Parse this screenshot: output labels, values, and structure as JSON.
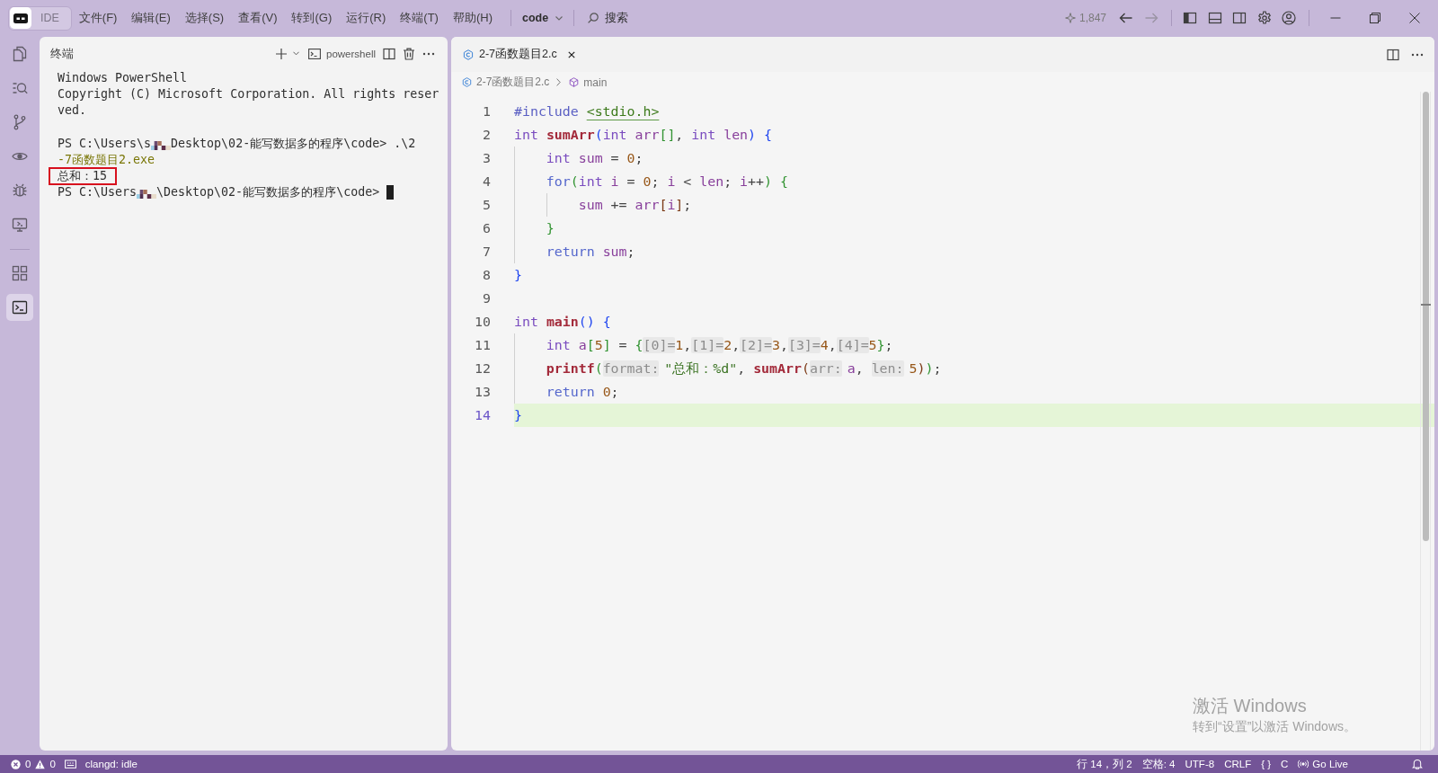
{
  "title_bar": {
    "app_label": "IDE",
    "menus": [
      "文件(F)",
      "编辑(E)",
      "选择(S)",
      "查看(V)",
      "转到(G)",
      "运行(R)",
      "终端(T)",
      "帮助(H)"
    ],
    "workspace": "code",
    "search_label": "搜索",
    "credits": "1,847",
    "nav": [
      {
        "kind": "back",
        "disabled": false
      },
      {
        "kind": "forward",
        "disabled": true
      }
    ],
    "layout_toggles": [
      {
        "kind": "primary",
        "on": true
      },
      {
        "kind": "panel",
        "on": false
      },
      {
        "kind": "secondary",
        "on": false
      }
    ]
  },
  "activity_bar": {
    "groups": [
      {
        "items": [
          {
            "kind": "explorer",
            "selected": false
          },
          {
            "kind": "search",
            "selected": false
          },
          {
            "kind": "scm",
            "selected": false
          },
          {
            "kind": "preview",
            "selected": false
          },
          {
            "kind": "debug",
            "selected": false
          },
          {
            "kind": "remote",
            "selected": false
          }
        ]
      },
      {
        "items": [
          {
            "kind": "extensions",
            "selected": false
          },
          {
            "kind": "terminal",
            "selected": true
          }
        ]
      }
    ]
  },
  "terminal": {
    "title": "终端",
    "shell": "powershell",
    "lines": [
      {
        "kind": "text",
        "boxed": false,
        "cursor": false,
        "segments": [
          {
            "kind": "text",
            "text": "Windows PowerShell"
          }
        ]
      },
      {
        "kind": "text",
        "boxed": false,
        "cursor": false,
        "segments": [
          {
            "kind": "text",
            "text": "Copyright (C) Microsoft Corporation. All rights reser"
          }
        ]
      },
      {
        "kind": "text",
        "boxed": false,
        "cursor": false,
        "segments": [
          {
            "kind": "text",
            "text": "ved."
          }
        ]
      },
      {
        "kind": "blank",
        "boxed": false,
        "cursor": false
      },
      {
        "kind": "text",
        "boxed": false,
        "cursor": false,
        "segments": [
          {
            "kind": "text",
            "text": "PS C:\\Users\\s"
          },
          {
            "kind": "redacted"
          },
          {
            "kind": "text",
            "text": "Desktop\\02-能写数据多的程序\\code> .\\2"
          }
        ]
      },
      {
        "kind": "text",
        "boxed": false,
        "cursor": false,
        "segments": [
          {
            "kind": "command",
            "text": "-7函数题目2.exe"
          }
        ]
      },
      {
        "kind": "text",
        "boxed": true,
        "cursor": false,
        "segments": [
          {
            "kind": "text",
            "text": "总和：15"
          }
        ]
      },
      {
        "kind": "text",
        "boxed": false,
        "cursor": true,
        "segments": [
          {
            "kind": "text",
            "text": "PS C:\\Users"
          },
          {
            "kind": "redacted"
          },
          {
            "kind": "text",
            "text": "\\Desktop\\02-能写数据多的程序\\code> "
          }
        ]
      }
    ]
  },
  "editor": {
    "tabs": [
      {
        "label": "2-7函数题目2.c",
        "selected": true
      }
    ],
    "breadcrumb": [
      {
        "kind": "file",
        "label": "2-7函数题目2.c"
      },
      {
        "kind": "function",
        "label": "main"
      }
    ],
    "lines": [
      {
        "number": "1",
        "current": false,
        "tokens": [
          {
            "kind": "directive",
            "text": "#include "
          },
          {
            "kind": "header",
            "text": "<stdio.h>"
          }
        ]
      },
      {
        "number": "2",
        "current": false,
        "tokens": [
          {
            "kind": "type",
            "text": "int "
          },
          {
            "kind": "func",
            "text": "sumArr"
          },
          {
            "kind": "bracket",
            "text": "("
          },
          {
            "kind": "type",
            "text": "int "
          },
          {
            "kind": "var",
            "text": "arr"
          },
          {
            "kind": "bracket2",
            "text": "[]"
          },
          {
            "kind": "punct",
            "text": ", "
          },
          {
            "kind": "type",
            "text": "int "
          },
          {
            "kind": "var",
            "text": "len"
          },
          {
            "kind": "bracket",
            "text": ") {"
          }
        ],
        "children": [
          {
            "number": "3",
            "current": false,
            "tokens": [
              {
                "kind": "type",
                "text": "int "
              },
              {
                "kind": "var",
                "text": "sum"
              },
              {
                "kind": "punct",
                "text": " = "
              },
              {
                "kind": "num",
                "text": "0"
              },
              {
                "kind": "punct",
                "text": ";"
              }
            ]
          },
          {
            "number": "4",
            "current": false,
            "tokens": [
              {
                "kind": "keyword",
                "text": "for"
              },
              {
                "kind": "bracket2",
                "text": "("
              },
              {
                "kind": "type",
                "text": "int "
              },
              {
                "kind": "var",
                "text": "i"
              },
              {
                "kind": "punct",
                "text": " = "
              },
              {
                "kind": "num",
                "text": "0"
              },
              {
                "kind": "punct",
                "text": "; "
              },
              {
                "kind": "var",
                "text": "i"
              },
              {
                "kind": "punct",
                "text": " < "
              },
              {
                "kind": "var",
                "text": "len"
              },
              {
                "kind": "punct",
                "text": "; "
              },
              {
                "kind": "var",
                "text": "i"
              },
              {
                "kind": "punct",
                "text": "++"
              },
              {
                "kind": "bracket2",
                "text": ") {"
              }
            ],
            "children": [
              {
                "number": "5",
                "current": false,
                "tokens": [
                  {
                    "kind": "var",
                    "text": "sum"
                  },
                  {
                    "kind": "punct",
                    "text": " += "
                  },
                  {
                    "kind": "var",
                    "text": "arr"
                  },
                  {
                    "kind": "bracket3",
                    "text": "["
                  },
                  {
                    "kind": "var",
                    "text": "i"
                  },
                  {
                    "kind": "bracket3",
                    "text": "]"
                  },
                  {
                    "kind": "punct",
                    "text": ";"
                  }
                ]
              }
            ]
          },
          {
            "number": "6",
            "current": false,
            "tokens": [
              {
                "kind": "bracket2",
                "text": "}"
              }
            ]
          },
          {
            "number": "7",
            "current": false,
            "tokens": [
              {
                "kind": "keyword",
                "text": "return "
              },
              {
                "kind": "var",
                "text": "sum"
              },
              {
                "kind": "punct",
                "text": ";"
              }
            ]
          }
        ]
      },
      {
        "number": "8",
        "current": false,
        "tokens": [
          {
            "kind": "bracket",
            "text": "}"
          }
        ]
      },
      {
        "number": "9",
        "current": false
      },
      {
        "number": "10",
        "current": false,
        "tokens": [
          {
            "kind": "type",
            "text": "int "
          },
          {
            "kind": "func",
            "text": "main"
          },
          {
            "kind": "bracket",
            "text": "() {"
          }
        ],
        "children": [
          {
            "number": "11",
            "current": false,
            "tokens": [
              {
                "kind": "type",
                "text": "int "
              },
              {
                "kind": "var",
                "text": "a"
              },
              {
                "kind": "bracket2",
                "text": "["
              },
              {
                "kind": "num",
                "text": "5"
              },
              {
                "kind": "bracket2",
                "text": "]"
              },
              {
                "kind": "punct",
                "text": " = "
              },
              {
                "kind": "bracket2",
                "text": "{"
              },
              {
                "kind": "designator",
                "text": "[0]="
              },
              {
                "kind": "num",
                "text": "1"
              },
              {
                "kind": "punct",
                "text": ","
              },
              {
                "kind": "designator",
                "text": "[1]="
              },
              {
                "kind": "num",
                "text": "2"
              },
              {
                "kind": "punct",
                "text": ","
              },
              {
                "kind": "designator",
                "text": "[2]="
              },
              {
                "kind": "num",
                "text": "3"
              },
              {
                "kind": "punct",
                "text": ","
              },
              {
                "kind": "designator",
                "text": "[3]="
              },
              {
                "kind": "num",
                "text": "4"
              },
              {
                "kind": "punct",
                "text": ","
              },
              {
                "kind": "designator",
                "text": "[4]="
              },
              {
                "kind": "num",
                "text": "5"
              },
              {
                "kind": "bracket2",
                "text": "}"
              },
              {
                "kind": "punct",
                "text": ";"
              }
            ]
          },
          {
            "number": "12",
            "current": false,
            "tokens": [
              {
                "kind": "func",
                "text": "printf"
              },
              {
                "kind": "bracket2",
                "text": "("
              },
              {
                "kind": "hint",
                "text": "format:"
              },
              {
                "kind": "str",
                "text": "\"总和：%d\""
              },
              {
                "kind": "punct",
                "text": ", "
              },
              {
                "kind": "func",
                "text": "sumArr"
              },
              {
                "kind": "bracket3",
                "text": "("
              },
              {
                "kind": "hint",
                "text": "arr:"
              },
              {
                "kind": "var",
                "text": "a"
              },
              {
                "kind": "punct",
                "text": ", "
              },
              {
                "kind": "hint",
                "text": "len:"
              },
              {
                "kind": "num",
                "text": "5"
              },
              {
                "kind": "bracket3",
                "text": ")"
              },
              {
                "kind": "bracket2",
                "text": ")"
              },
              {
                "kind": "punct",
                "text": ";"
              }
            ]
          },
          {
            "number": "13",
            "current": false,
            "tokens": [
              {
                "kind": "keyword",
                "text": "return "
              },
              {
                "kind": "num",
                "text": "0"
              },
              {
                "kind": "punct",
                "text": ";"
              }
            ]
          }
        ]
      },
      {
        "number": "14",
        "current": true,
        "tokens": [
          {
            "kind": "bracket",
            "text": "}"
          }
        ]
      }
    ]
  },
  "activation_notice": {
    "title": "激活 Windows",
    "text": "转到“设置”以激活 Windows。"
  },
  "status_bar": {
    "errors": "0",
    "warnings": "0",
    "server": "clangd: idle",
    "cursor_position": "行 14，列 2",
    "indentation": "空格: 4",
    "encoding": "UTF-8",
    "line_ending": "CRLF",
    "braces": "{ }",
    "language": "C",
    "live": "Go Live"
  }
}
